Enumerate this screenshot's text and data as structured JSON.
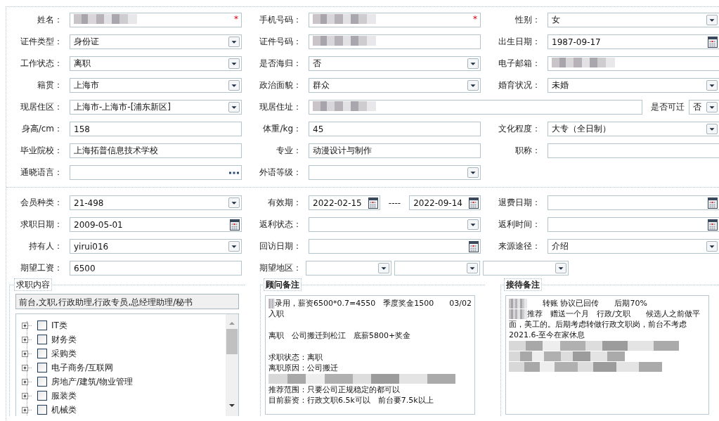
{
  "sections": [
    {
      "rows": [
        [
          {
            "kind": "single",
            "label": "姓名：",
            "fields": [
              {
                "kind": "text",
                "redacted": true,
                "marker": "*"
              }
            ]
          },
          {
            "kind": "single",
            "label": "手机号码：",
            "fields": [
              {
                "kind": "text",
                "redacted": true,
                "marker": "*"
              }
            ]
          },
          {
            "kind": "single",
            "label": "性别：",
            "fields": [
              {
                "kind": "select",
                "value": "女"
              }
            ]
          }
        ],
        [
          {
            "kind": "single",
            "label": "证件类型：",
            "fields": [
              {
                "kind": "select",
                "value": "身份证"
              }
            ]
          },
          {
            "kind": "single",
            "label": "证件号码：",
            "fields": [
              {
                "kind": "text",
                "redacted": true
              }
            ]
          },
          {
            "kind": "single",
            "label": "出生日期：",
            "fields": [
              {
                "kind": "date",
                "value": "1987-09-17"
              }
            ]
          }
        ],
        [
          {
            "kind": "single",
            "label": "工作状态：",
            "fields": [
              {
                "kind": "select",
                "value": "离职"
              }
            ]
          },
          {
            "kind": "single",
            "label": "是否海归：",
            "fields": [
              {
                "kind": "select",
                "value": "否"
              }
            ]
          },
          {
            "kind": "single",
            "label": "电子邮箱：",
            "fields": [
              {
                "kind": "text",
                "redacted": true
              }
            ]
          }
        ],
        [
          {
            "kind": "single",
            "label": "籍贯：",
            "fields": [
              {
                "kind": "select",
                "value": "上海市"
              }
            ]
          },
          {
            "kind": "single",
            "label": "政治面貌：",
            "fields": [
              {
                "kind": "select",
                "value": "群众"
              }
            ]
          },
          {
            "kind": "single",
            "label": "婚育状况：",
            "fields": [
              {
                "kind": "select",
                "value": "未婚"
              }
            ]
          }
        ],
        [
          {
            "kind": "single",
            "label": "现居住区：",
            "fields": [
              {
                "kind": "select",
                "value": "上海市-上海市-[浦东新区]"
              }
            ]
          },
          {
            "kind": "address",
            "label": "现居住址：",
            "fields": [
              {
                "kind": "text",
                "redacted": true
              },
              {
                "kind": "label",
                "value": "是否可迁"
              },
              {
                "kind": "select",
                "value": "否"
              }
            ]
          }
        ],
        [
          {
            "kind": "single",
            "label": "身高/cm：",
            "fields": [
              {
                "kind": "text",
                "value": "158"
              }
            ]
          },
          {
            "kind": "single",
            "label": "体重/kg：",
            "fields": [
              {
                "kind": "text",
                "value": "45"
              }
            ]
          },
          {
            "kind": "single",
            "label": "文化程度：",
            "fields": [
              {
                "kind": "select",
                "value": "大专（全日制）"
              }
            ]
          }
        ],
        [
          {
            "kind": "single",
            "label": "毕业院校：",
            "fields": [
              {
                "kind": "text",
                "value": "上海拓普信息技术学校"
              }
            ]
          },
          {
            "kind": "single",
            "label": "专业：",
            "fields": [
              {
                "kind": "text",
                "value": "动漫设计与制作"
              }
            ]
          },
          {
            "kind": "single",
            "label": "职称：",
            "fields": [
              {
                "kind": "text"
              }
            ]
          }
        ],
        [
          {
            "kind": "single",
            "label": "通晓语言：",
            "fields": [
              {
                "kind": "lookup"
              }
            ]
          },
          {
            "kind": "single",
            "label": "外语等级：",
            "fields": [
              {
                "kind": "select"
              }
            ]
          }
        ]
      ]
    },
    {
      "rows": [
        [
          {
            "kind": "single",
            "label": "会员种类：",
            "fields": [
              {
                "kind": "select",
                "value": "21-498"
              }
            ]
          },
          {
            "kind": "range",
            "label": "有效期：",
            "fields": [
              {
                "kind": "date",
                "value": "2022-02-15"
              },
              {
                "kind": "label",
                "value": "----"
              },
              {
                "kind": "date",
                "value": "2022-09-14"
              }
            ]
          },
          {
            "kind": "single",
            "label": "退费日期：",
            "fields": [
              {
                "kind": "date"
              }
            ]
          }
        ],
        [
          {
            "kind": "single",
            "label": "求职日期：",
            "fields": [
              {
                "kind": "date",
                "value": "2009-05-01"
              }
            ]
          },
          {
            "kind": "single",
            "label": "返利状态：",
            "fields": [
              {
                "kind": "select"
              }
            ]
          },
          {
            "kind": "single",
            "label": "返利时间：",
            "fields": [
              {
                "kind": "date"
              }
            ]
          }
        ],
        [
          {
            "kind": "single",
            "label": "持有人：",
            "fields": [
              {
                "kind": "select",
                "value": "yirui016"
              }
            ]
          },
          {
            "kind": "single",
            "label": "回访日期：",
            "fields": [
              {
                "kind": "date"
              }
            ]
          },
          {
            "kind": "single",
            "label": "来源途径：",
            "fields": [
              {
                "kind": "select",
                "value": "介绍"
              }
            ]
          }
        ],
        [
          {
            "kind": "single",
            "label": "期望工资：",
            "fields": [
              {
                "kind": "text",
                "value": "6500"
              }
            ]
          },
          {
            "kind": "region",
            "label": "期望地区：",
            "fields": [
              {
                "kind": "select"
              },
              {
                "kind": "select"
              },
              {
                "kind": "select"
              }
            ]
          }
        ]
      ]
    }
  ],
  "job_panel": {
    "legend": "求职内容",
    "selection": "前台,文职,行政助理,行政专员,总经理助理/秘书",
    "tree": [
      {
        "label": "IT类",
        "checked": false,
        "expanded": false
      },
      {
        "label": "财务类",
        "checked": false,
        "expanded": false
      },
      {
        "label": "采购类",
        "checked": false,
        "expanded": false
      },
      {
        "label": "电子商务/互联网",
        "checked": false,
        "expanded": false
      },
      {
        "label": "房地产/建筑/物业管理",
        "checked": false,
        "expanded": false
      },
      {
        "label": "服装类",
        "checked": false,
        "expanded": false
      },
      {
        "label": "机械类",
        "checked": false,
        "expanded": false
      }
    ]
  },
  "notes": [
    {
      "legend": "顾问备注",
      "paragraphs": [
        [
          {
            "kind": "text",
            "redacted_prefix": true,
            "text": "录用，薪资6500*0.7=4550　季度奖金1500　　03/02"
          },
          {
            "kind": "text",
            "text": "入职"
          }
        ],
        [
          {
            "kind": "text",
            "text": "离职　公司搬迁到松江　底薪5800+奖金"
          }
        ],
        [
          {
            "kind": "text",
            "text": "求职状态：离职"
          },
          {
            "kind": "text",
            "text": "离职原因：公司搬迁"
          },
          {
            "kind": "redacted"
          },
          {
            "kind": "text",
            "text": "推荐范围：只要公司正规稳定的都可以"
          },
          {
            "kind": "text",
            "text": "目前薪资：行政文职6.5k可以　前台要7.5k以上"
          }
        ]
      ]
    },
    {
      "legend": "接待备注",
      "paragraphs": [
        [
          {
            "kind": "text",
            "redacted_prefix": true,
            "text": "　　转账 协议已回传　　后期70%"
          },
          {
            "kind": "text",
            "redacted_prefix": true,
            "text": "推荐　赠送一个月　行政/文职　　候选人之前做平"
          },
          {
            "kind": "text",
            "text": "面，美工的。后期考虑转做行政文职岗，前台不考虑"
          },
          {
            "kind": "text",
            "text": "2021.6-至今在家休息"
          },
          {
            "kind": "redacted"
          },
          {
            "kind": "redacted"
          },
          {
            "kind": "redacted"
          }
        ]
      ]
    }
  ]
}
